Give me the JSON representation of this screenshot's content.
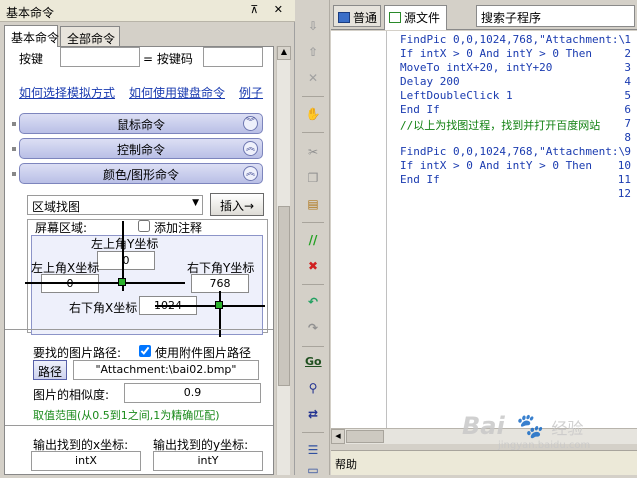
{
  "left_panel": {
    "title": "基本命令",
    "title_buttons": "⊼ ✕",
    "tabs": [
      "基本命令",
      "全部命令"
    ],
    "key_label": "按键",
    "keycode_label": "= 按键码",
    "links": [
      "如何选择模拟方式",
      "如何使用键盘命令",
      "例子"
    ],
    "sections": [
      "鼠标命令",
      "控制命令",
      "颜色/图形命令"
    ],
    "function_select": "区域找图",
    "insert_button": "插入→",
    "screen_area_label": "屏幕区域:",
    "add_comment_label": "添加注释",
    "top_left_y_label": "左上角Y坐标",
    "top_left_y_value": "0",
    "top_left_x_label": "左上角X坐标",
    "top_left_x_value": "0",
    "bottom_right_y_label": "右下角Y坐标",
    "bottom_right_y_value": "768",
    "bottom_right_x_label": "右下角X坐标",
    "bottom_right_x_value": "1024",
    "image_path_label": "要找的图片路径:",
    "use_attachment_label": "使用附件图片路径",
    "path_button": "路径",
    "path_value": "\"Attachment:\\bai02.bmp\"",
    "similarity_label": "图片的相似度:",
    "similarity_value": "0.9",
    "similarity_hint": "取值范围(从0.5到1之间,1为精确匹配)",
    "output_x_label": "输出找到的x坐标:",
    "output_x_value": "intX",
    "output_y_label": "输出找到的y坐标:",
    "output_y_value": "intY"
  },
  "toolbar": {
    "icons": [
      "arrow-down-icon",
      "arrow-up-icon",
      "delete-icon",
      "hand-icon",
      "cut-icon",
      "copy-icon",
      "paste-icon",
      "comment-icon",
      "uncomment-icon",
      "undo-icon",
      "redo-icon",
      "go-icon",
      "find-icon",
      "replace-icon",
      "list-icon",
      "panel-icon"
    ]
  },
  "editor": {
    "tabs": [
      "普通",
      "源文件"
    ],
    "search_box": "搜索子程序",
    "line_numbers": [
      "1",
      "2",
      "3",
      "4",
      "5",
      "6",
      "7",
      "8",
      "9",
      "10",
      "11",
      "12"
    ],
    "lines": [
      "FindPic 0,0,1024,768,\"Attachment:\\",
      "If intX > 0 And intY > 0 Then",
      "MoveTo intX+20, intY+20",
      "Delay 200",
      "LeftDoubleClick 1",
      "End If",
      "//以上为找图过程，找到并打开百度网站",
      "",
      "FindPic 0,0,1024,768,\"Attachment:\\",
      "If intX > 0 And intY > 0 Then",
      "End If",
      ""
    ],
    "help_label": "帮助"
  },
  "watermark": {
    "brand": "Bai",
    "brand_tail": "经验",
    "url": "jingyan.baidu.com"
  },
  "colors": {
    "link": "#1a3bb0",
    "hint_green": "#1a8a1a",
    "section_button": "#b9bfe6",
    "code_text": "#1a3bb0",
    "comment_text": "#108010"
  }
}
